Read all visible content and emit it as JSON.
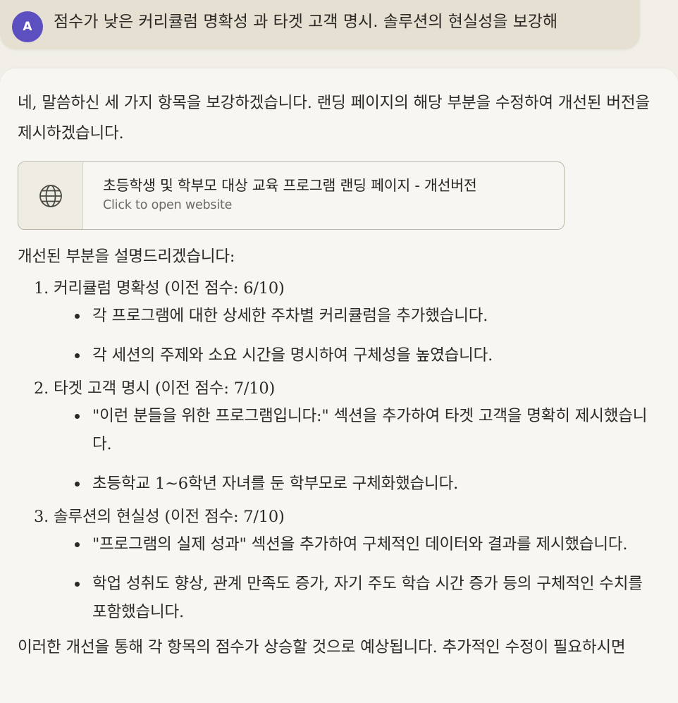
{
  "user_message": {
    "avatar_initial": "A",
    "text": "점수가 낮은 커리큘럼 명확성 과  타겟 고객 명시. 솔루션의 현실성을 보강해"
  },
  "response": {
    "intro": "네, 말씀하신 세 가지 항목을 보강하겠습니다. 랜딩 페이지의 해당 부분을 수정하여 개선된 버전을 제시하겠습니다.",
    "artifact": {
      "icon": "globe-icon",
      "title": "초등학생 및 학부모 대상 교육 프로그램 랜딩 페이지 - 개선버전",
      "subtitle": "Click to open website"
    },
    "lead": "개선된 부분을 설명드리겠습니다:",
    "sections": [
      {
        "title": "1. 커리큘럼 명확성 (이전 점수: 6/10)",
        "bullets": [
          "각 프로그램에 대한 상세한 주차별 커리큘럼을 추가했습니다.",
          "각 세션의 주제와 소요 시간을 명시하여 구체성을 높였습니다."
        ]
      },
      {
        "title": "2. 타겟 고객 명시 (이전 점수: 7/10)",
        "bullets": [
          "\"이런 분들을 위한 프로그램입니다:\" 섹션을 추가하여 타겟 고객을 명확히 제시했습니다.",
          "초등학교 1~6학년 자녀를 둔 학부모로 구체화했습니다."
        ]
      },
      {
        "title": "3. 솔루션의 현실성 (이전 점수: 7/10)",
        "bullets": [
          "\"프로그램의 실제 성과\" 섹션을 추가하여 구체적인 데이터와 결과를 제시했습니다.",
          "학업 성취도 향상, 관계 만족도 증가, 자기 주도 학습 시간 증가 등의 구체적인 수치를 포함했습니다."
        ]
      }
    ],
    "trailing": "이러한 개선을 통해 각 항목의 점수가 상승할 것으로 예상됩니다. 추가적인 수정이 필요하시면"
  }
}
